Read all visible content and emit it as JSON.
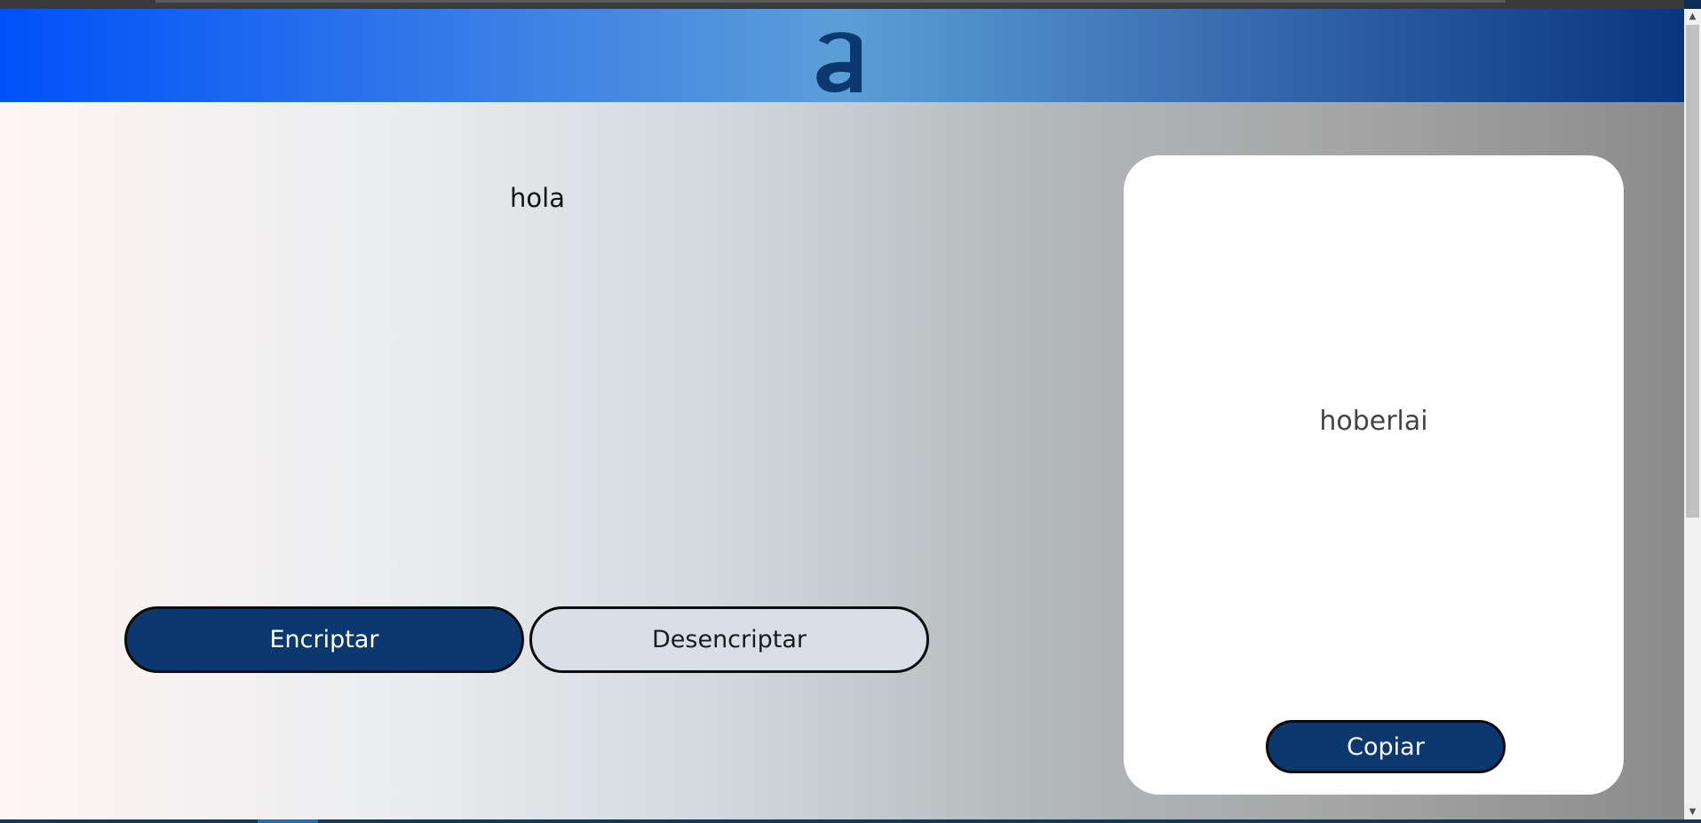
{
  "header": {
    "logo_icon": "alura-logo-icon",
    "logo_color": "#0b386e"
  },
  "input": {
    "value": "hola"
  },
  "buttons": {
    "encrypt_label": "Encriptar",
    "decrypt_label": "Desencriptar",
    "copy_label": "Copiar"
  },
  "result": {
    "text": "hoberlai"
  },
  "colors": {
    "primary": "#0b386e",
    "secondary": "#d8dfe9"
  }
}
